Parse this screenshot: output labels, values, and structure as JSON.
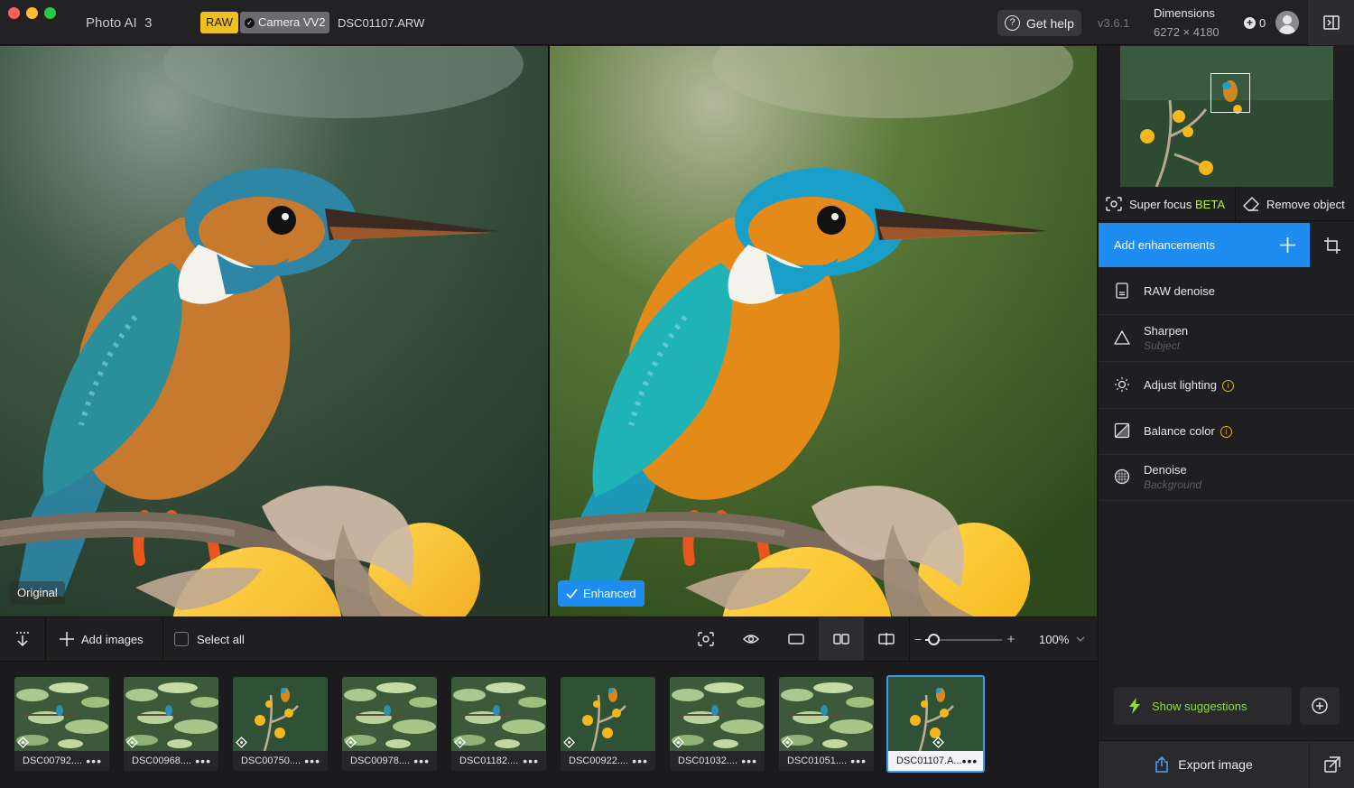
{
  "window": {
    "app_name": "Photo AI",
    "app_version_major": "3",
    "format_badge": "RAW",
    "camera_badge": "Camera VV2",
    "filename": "DSC01107.ARW",
    "help_label": "Get help",
    "version": "v3.6.1",
    "dimensions_label": "Dimensions",
    "dimensions_value": "6272 × 4180",
    "credits": "0"
  },
  "viewer": {
    "original_label": "Original",
    "enhanced_label": "Enhanced"
  },
  "toolbar": {
    "add_images_label": "Add images",
    "select_all_label": "Select all",
    "zoom_value": "100%",
    "zoom_level": 0.1
  },
  "filmstrip": {
    "items": [
      {
        "name": "DSC00792....",
        "scene": "lilypads"
      },
      {
        "name": "DSC00968....",
        "scene": "lilypads"
      },
      {
        "name": "DSC00750....",
        "scene": "branch"
      },
      {
        "name": "DSC00978....",
        "scene": "lilypads"
      },
      {
        "name": "DSC01182....",
        "scene": "lilypads"
      },
      {
        "name": "DSC00922....",
        "scene": "branch"
      },
      {
        "name": "DSC01032....",
        "scene": "lilypads"
      },
      {
        "name": "DSC01051....",
        "scene": "lilypads"
      },
      {
        "name": "DSC01107.A...",
        "scene": "branch",
        "selected": true
      }
    ]
  },
  "panel": {
    "super_focus_label": "Super focus",
    "super_focus_badge": "BETA",
    "remove_object_label": "Remove object",
    "add_enhancements_label": "Add enhancements",
    "enhancements": [
      {
        "title": "RAW denoise",
        "subtitle": "",
        "icon": "raw-file-icon",
        "info": false
      },
      {
        "title": "Sharpen",
        "subtitle": "Subject",
        "icon": "triangle-icon",
        "info": false
      },
      {
        "title": "Adjust lighting",
        "subtitle": "",
        "icon": "sun-icon",
        "info": true
      },
      {
        "title": "Balance color",
        "subtitle": "",
        "icon": "color-balance-icon",
        "info": true
      },
      {
        "title": "Denoise",
        "subtitle": "Background",
        "icon": "grain-icon",
        "info": false
      }
    ],
    "show_suggestions_label": "Show suggestions",
    "export_label": "Export image"
  },
  "colors": {
    "accent": "#1e8cf0",
    "raw_badge": "#f2c01e",
    "beta": "#b8f03c",
    "suggestion": "#8fdc3a",
    "info": "#e8b21a"
  }
}
